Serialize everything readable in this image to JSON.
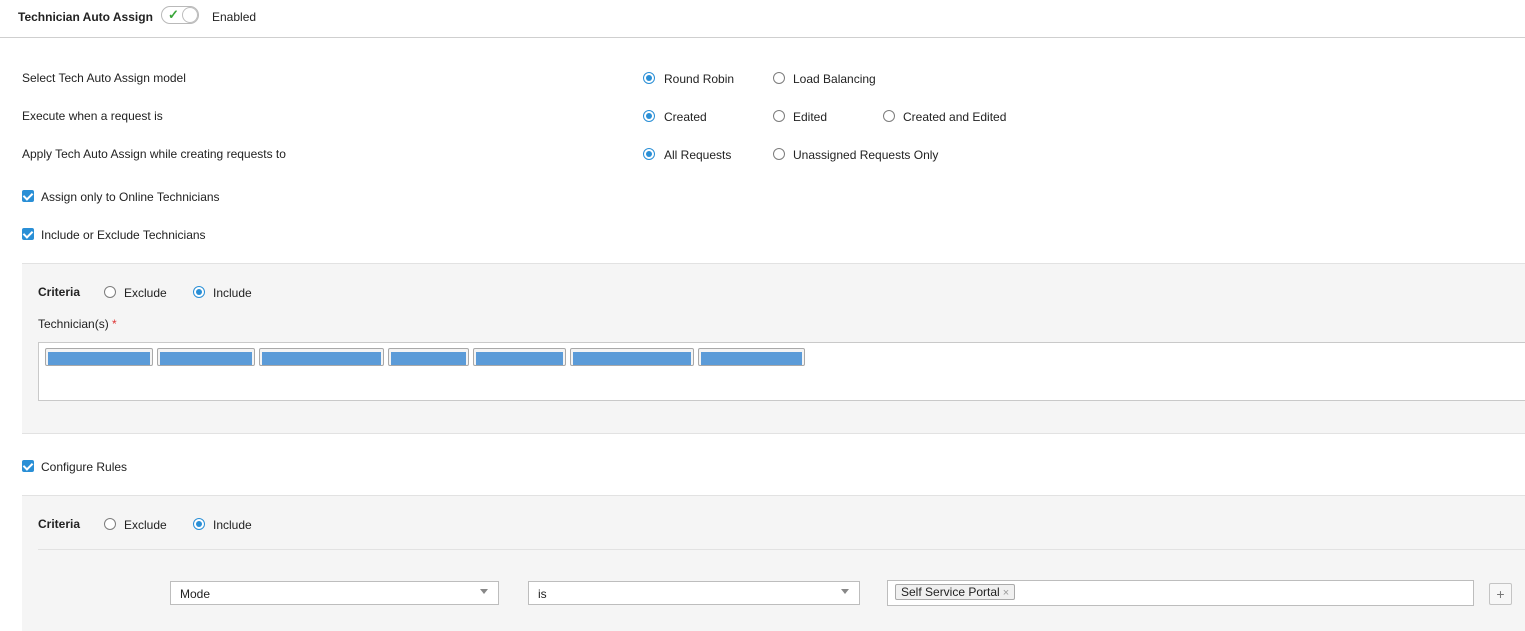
{
  "header": {
    "title": "Technician Auto Assign",
    "toggle_state": "Enabled"
  },
  "settings": {
    "model": {
      "label": "Select Tech Auto Assign model",
      "options": [
        "Round Robin",
        "Load Balancing"
      ],
      "selected": "Round Robin"
    },
    "execute": {
      "label": "Execute when a request is",
      "options": [
        "Created",
        "Edited",
        "Created and Edited"
      ],
      "selected": "Created"
    },
    "apply": {
      "label": "Apply Tech Auto Assign while creating requests to",
      "options": [
        "All Requests",
        "Unassigned Requests Only"
      ],
      "selected": "All Requests"
    }
  },
  "checkboxes": {
    "online_only": "Assign only to Online Technicians",
    "include_exclude": "Include or Exclude Technicians",
    "configure_rules": "Configure Rules"
  },
  "tech_criteria": {
    "label": "Criteria",
    "options": [
      "Exclude",
      "Include"
    ],
    "selected": "Include",
    "field_label": "Technician(s)",
    "required_mark": "*",
    "selected_chip_count": 7
  },
  "rule_criteria": {
    "label": "Criteria",
    "options": [
      "Exclude",
      "Include"
    ],
    "selected": "Include",
    "rule": {
      "field": "Mode",
      "operator": "is",
      "value_tag": "Self Service Portal",
      "remove_glyph": "×",
      "add_glyph": "+"
    }
  },
  "colors": {
    "accent": "#2a8fd6",
    "toggle_check": "#3aa63a",
    "chip_highlight": "#5b9bd8",
    "required": "#dd3333"
  }
}
